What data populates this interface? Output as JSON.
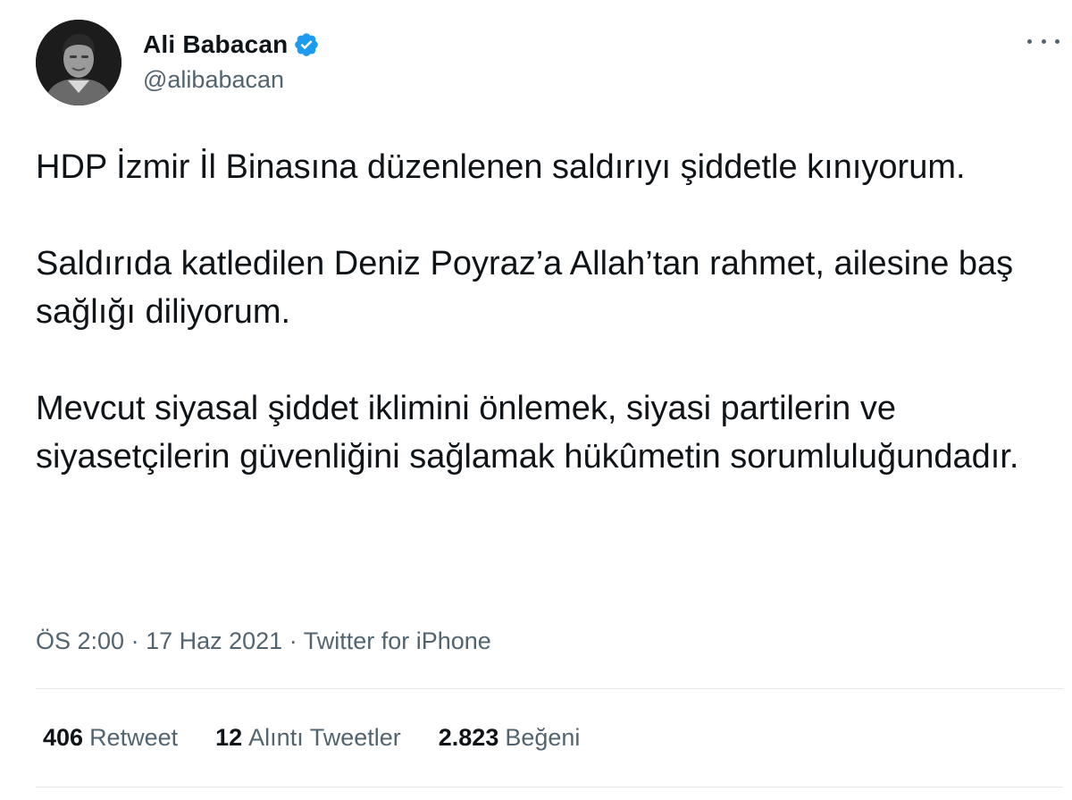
{
  "author": {
    "display_name": "Ali Babacan",
    "handle": "@alibabacan",
    "verified": true,
    "avatar_icon": "user-avatar-photo",
    "verified_icon": "verified-badge-icon"
  },
  "header": {
    "more_icon": "more-options-icon"
  },
  "tweet": {
    "paragraphs": [
      "HDP İzmir İl Binasına düzenlenen saldırıyı şiddetle kınıyorum.",
      "Saldırıda katledilen Deniz Poyraz’a Allah’tan rahmet, ailesine baş sağlığı diliyorum.",
      "Mevcut siyasal şiddet iklimini önlemek, siyasi partilerin ve siyasetçilerin güvenliğini sağlamak hükûmetin sorumluluğundadır."
    ]
  },
  "meta": {
    "time": "ÖS 2:00",
    "separator": " · ",
    "date": "17 Haz 2021",
    "source": "Twitter for iPhone"
  },
  "stats": {
    "retweets": {
      "count": "406",
      "label": "Retweet"
    },
    "quotes": {
      "count": "12",
      "label": "Alıntı Tweetler"
    },
    "likes": {
      "count": "2.823",
      "label": "Beğeni"
    }
  },
  "colors": {
    "text_primary": "#0f1419",
    "text_secondary": "#536471",
    "verified_blue": "#1d9bf0",
    "divider": "#e5e9ec"
  }
}
